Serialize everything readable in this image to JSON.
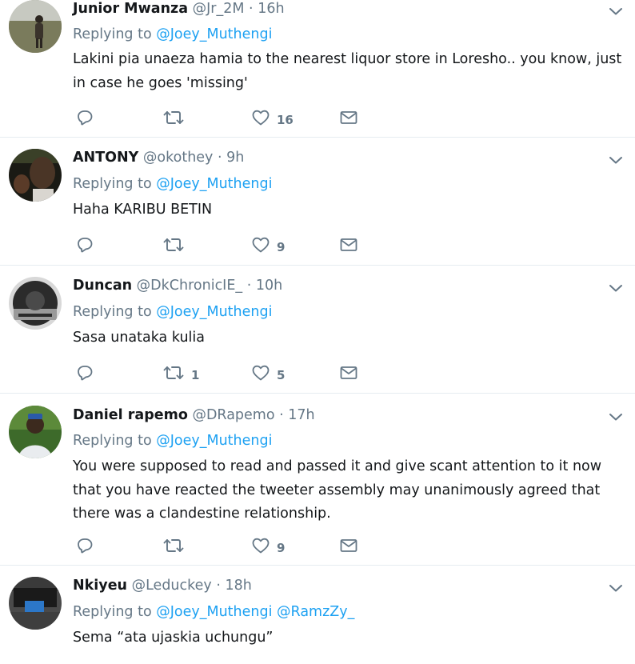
{
  "tweets": [
    {
      "name": "Junior Mwanza",
      "handle": "@Jr_2M",
      "dot": "·",
      "time": "16h",
      "replying_prefix": "Replying to",
      "replying_to": "@Joey_Muthengi",
      "replying_to_2": "",
      "text": "Lakini pia unaeza hamia to the nearest liquor store in Loresho.. you know, just in case he goes 'missing'",
      "replies": "",
      "retweets": "",
      "likes": "16"
    },
    {
      "name": "ANTONY",
      "handle": "@okothey",
      "dot": "·",
      "time": "9h",
      "replying_prefix": "Replying to",
      "replying_to": "@Joey_Muthengi",
      "replying_to_2": "",
      "text": "Haha KARIBU BETIN",
      "replies": "",
      "retweets": "",
      "likes": "9"
    },
    {
      "name": "Duncan",
      "handle": "@DkChronicIE_",
      "dot": "·",
      "time": "10h",
      "replying_prefix": "Replying to",
      "replying_to": "@Joey_Muthengi",
      "replying_to_2": "",
      "text": "Sasa unataka kulia",
      "replies": "",
      "retweets": "1",
      "likes": "5"
    },
    {
      "name": "Daniel rapemo",
      "handle": "@DRapemo",
      "dot": "·",
      "time": "17h",
      "replying_prefix": "Replying to",
      "replying_to": "@Joey_Muthengi",
      "replying_to_2": "",
      "text": "You were supposed to read and passed it and give scant attention to it now that you have reacted the tweeter assembly may unanimously agreed that there was a clandestine relationship.",
      "replies": "",
      "retweets": "",
      "likes": "9"
    },
    {
      "name": "Nkiyeu",
      "handle": "@Leduckey",
      "dot": "·",
      "time": "18h",
      "replying_prefix": "Replying to",
      "replying_to": "@Joey_Muthengi",
      "replying_to_2": "@RamzZy_",
      "text": "Sema “ata ujaskia uchungu”",
      "replies": "",
      "retweets": "",
      "likes": ""
    }
  ],
  "icons": {
    "reply": "reply-icon",
    "retweet": "retweet-icon",
    "like": "heart-icon",
    "dm": "envelope-icon",
    "caret": "chevron-down-icon"
  },
  "colors": {
    "text": "#14171a",
    "muted": "#657786",
    "link": "#1da1f2",
    "separator": "#e6ecf0"
  }
}
